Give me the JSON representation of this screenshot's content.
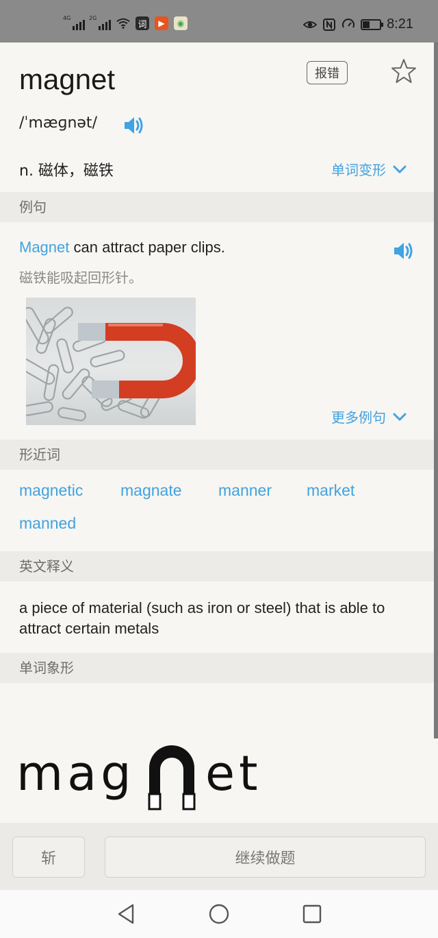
{
  "status_bar": {
    "signal_1": "4G",
    "signal_2": "2G",
    "time": "8:21",
    "icons": [
      "wifi-icon",
      "dictionary-app-icon",
      "video-app-icon",
      "game-app-icon",
      "eye-icon",
      "nfc-icon",
      "speed-icon",
      "battery-icon"
    ]
  },
  "word": {
    "headword": "magnet",
    "report_label": "报错",
    "phonetic": "/ˈmæɡnət/",
    "definition": "n. 磁体，磁铁",
    "forms_link": "单词变形"
  },
  "examples": {
    "header": "例句",
    "sentence_highlight": "Magnet",
    "sentence_rest": " can attract paper clips.",
    "translation": "磁铁能吸起回形针。",
    "more_link": "更多例句"
  },
  "similar_words": {
    "header": "形近词",
    "items": [
      "magnetic",
      "magnate",
      "manner",
      "market",
      "manned"
    ]
  },
  "english_definition": {
    "header": "英文释义",
    "text": "a piece of material (such as iron or steel) that is able to attract certain metals"
  },
  "pictogram": {
    "header": "单词象形",
    "left_text": "mag",
    "right_text": "et"
  },
  "bottom_bar": {
    "cut_label": "斩",
    "continue_label": "继续做题"
  },
  "colors": {
    "accent": "#41a2e0",
    "status_bar": "#8a8a8a",
    "section_header": "#ecebe7",
    "background": "#f7f6f2"
  }
}
